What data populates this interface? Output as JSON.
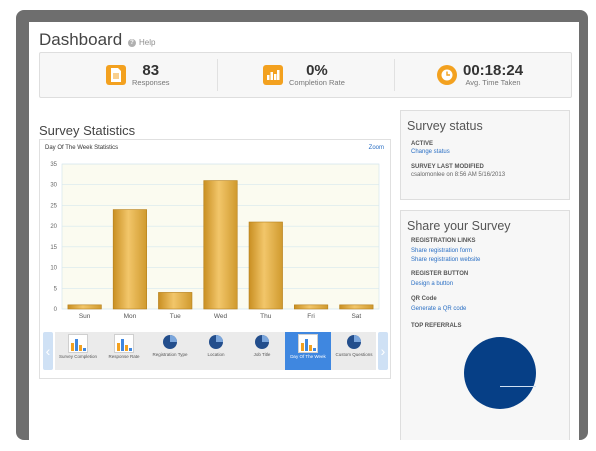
{
  "header": {
    "title": "Dashboard",
    "help_label": "Help"
  },
  "kpis": [
    {
      "value": "83",
      "label": "Responses",
      "icon": "document-icon"
    },
    {
      "value": "0%",
      "label": "Completion Rate",
      "icon": "bar-chart-icon"
    },
    {
      "value": "00:18:24",
      "label": "Avg. Time Taken",
      "icon": "clock-icon"
    }
  ],
  "stats": {
    "section_title": "Survey Statistics",
    "zoom_label": "Zoom"
  },
  "chart_data": {
    "type": "bar",
    "title": "Day Of The Week Statistics",
    "categories": [
      "Sun",
      "Mon",
      "Tue",
      "Wed",
      "Thu",
      "Fri",
      "Sat"
    ],
    "values": [
      1,
      24,
      4,
      31,
      21,
      1,
      1
    ],
    "ylim": [
      0,
      35
    ],
    "yticks": [
      0,
      5,
      10,
      15,
      20,
      25,
      30,
      35
    ],
    "grid": true,
    "bar_color": "#e6b24a"
  },
  "carousel": [
    {
      "label": "Survey Completion",
      "type": "bar"
    },
    {
      "label": "Response Rate",
      "type": "bar"
    },
    {
      "label": "Registration Type",
      "type": "pie"
    },
    {
      "label": "Location",
      "type": "pie"
    },
    {
      "label": "Job Title",
      "type": "pie"
    },
    {
      "label": "Day Of The Week",
      "type": "bar",
      "active": true
    },
    {
      "label": "Custom Questions",
      "type": "pie"
    }
  ],
  "status": {
    "title": "Survey status",
    "state": "ACTIVE",
    "change_link": "Change status",
    "modified_label": "SURVEY LAST MODIFIED",
    "modified_text": "csalomonlee on 8:56 AM 5/16/2013"
  },
  "share": {
    "title": "Share your Survey",
    "reg_links_label": "REGISTRATION LINKS",
    "reg_form_link": "Share registration form",
    "reg_site_link": "Share registration website",
    "reg_button_label": "REGISTER BUTTON",
    "design_link": "Design a button",
    "qr_label": "QR Code",
    "qr_link": "Generate a QR code",
    "referrals_label": "TOP REFERRALS"
  },
  "colors": {
    "accent": "#f3a11f",
    "link": "#2a6fc4",
    "pie": "#063f86"
  }
}
